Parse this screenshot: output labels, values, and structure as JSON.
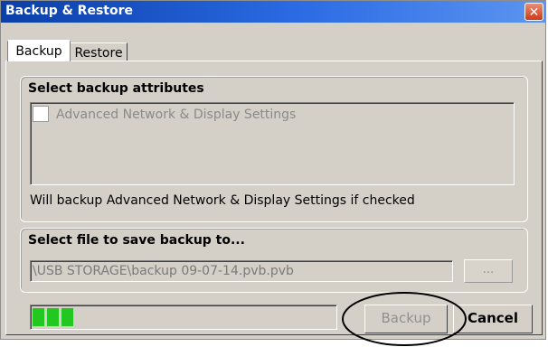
{
  "window": {
    "title": "Backup & Restore",
    "close_glyph": "✕"
  },
  "tabs": [
    {
      "label": "Backup",
      "selected": true
    },
    {
      "label": "Restore",
      "selected": false
    }
  ],
  "attributes": {
    "title": "Select backup attributes",
    "checkbox_label": "Advanced Network & Display Settings",
    "checked": false,
    "hint": "Will backup Advanced Network & Display Settings if checked"
  },
  "file": {
    "title": "Select file to save backup to...",
    "path": "\\USB STORAGE\\backup 09-07-14.pvb.pvb",
    "browse_label": "..."
  },
  "progress": {
    "fraction": 0.15
  },
  "buttons": {
    "backup_label": "Backup",
    "cancel_label": "Cancel"
  },
  "colors": {
    "title_bar": "#0a3fa8",
    "progress_fill": "#22c71f",
    "dialog_bg": "#d4d0c8"
  }
}
